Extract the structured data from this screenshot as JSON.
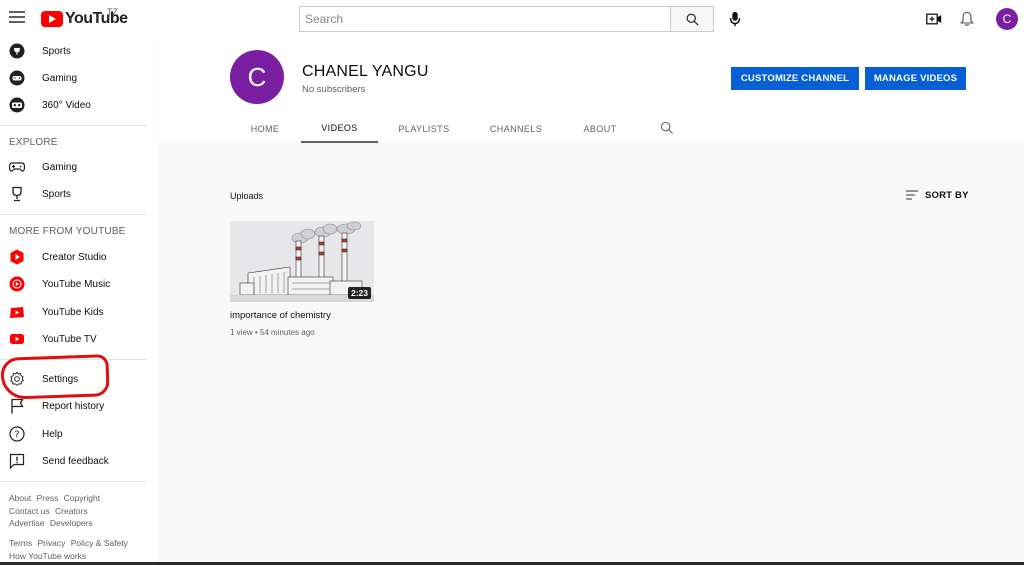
{
  "topbar": {
    "logo_text": "YouTube",
    "region": "TZ",
    "search_placeholder": "Search",
    "avatar_letter": "C"
  },
  "sidebar": {
    "top_items": [
      {
        "label": "Sports",
        "icon": "trophy-icon"
      },
      {
        "label": "Gaming",
        "icon": "gaming-icon"
      },
      {
        "label": "360° Video",
        "icon": "vr-icon"
      }
    ],
    "explore_heading": "EXPLORE",
    "explore_items": [
      {
        "label": "Gaming",
        "icon": "gamepad-icon"
      },
      {
        "label": "Sports",
        "icon": "trophy-outline-icon"
      }
    ],
    "more_heading": "MORE FROM YOUTUBE",
    "more_items": [
      {
        "label": "Creator Studio",
        "icon": "creator-studio-icon"
      },
      {
        "label": "YouTube Music",
        "icon": "youtube-music-icon"
      },
      {
        "label": "YouTube Kids",
        "icon": "youtube-kids-icon"
      },
      {
        "label": "YouTube TV",
        "icon": "youtube-tv-icon"
      }
    ],
    "settings_items": [
      {
        "label": "Settings",
        "icon": "gear-icon"
      },
      {
        "label": "Report history",
        "icon": "flag-icon"
      },
      {
        "label": "Help",
        "icon": "help-icon"
      },
      {
        "label": "Send feedback",
        "icon": "feedback-icon"
      }
    ],
    "footer_row1": [
      "About",
      "Press",
      "Copyright"
    ],
    "footer_row2": [
      "Contact us",
      "Creators"
    ],
    "footer_row3": [
      "Advertise",
      "Developers"
    ],
    "footer_row4": [
      "Terms",
      "Privacy",
      "Policy & Safety"
    ],
    "footer_row5": [
      "How YouTube works"
    ]
  },
  "channel": {
    "avatar_letter": "C",
    "name": "CHANEL YANGU",
    "subscribers": "No subscribers",
    "customize_label": "CUSTOMIZE CHANNEL",
    "manage_label": "MANAGE VIDEOS",
    "tabs": [
      "HOME",
      "VIDEOS",
      "PLAYLISTS",
      "CHANNELS",
      "ABOUT"
    ],
    "active_tab": "VIDEOS"
  },
  "content": {
    "section_title": "Uploads",
    "sort_label": "SORT BY",
    "videos": [
      {
        "title": "importance of chemistry",
        "duration": "2:23",
        "meta": "1 view • 54 minutes ago"
      }
    ]
  },
  "colors": {
    "accent_blue": "#065fd4",
    "avatar_purple": "#7b1fa2",
    "brand_red": "#ff0000",
    "annotation_red": "#e01010"
  }
}
